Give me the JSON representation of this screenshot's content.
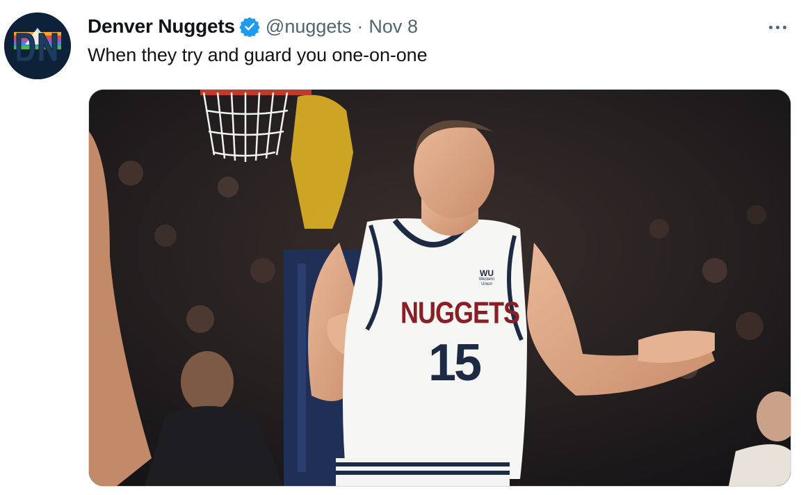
{
  "tweet": {
    "author_name": "Denver Nuggets",
    "handle": "@nuggets",
    "separator": "·",
    "date": "Nov 8",
    "text": "When they try and guard you one-on-one",
    "avatar_initials": "DN",
    "verified_color": "#1d9bf0"
  },
  "media": {
    "jersey_text": "NUGGETS",
    "jersey_number": "15",
    "sponsor_logo": "WU",
    "sponsor_name": "Western Union"
  },
  "colors": {
    "text_primary": "#0f1419",
    "text_secondary": "#536471",
    "border": "#cfd9de"
  },
  "icons": {
    "verified": "verified-badge-icon",
    "more": "more-horizontal-icon"
  }
}
